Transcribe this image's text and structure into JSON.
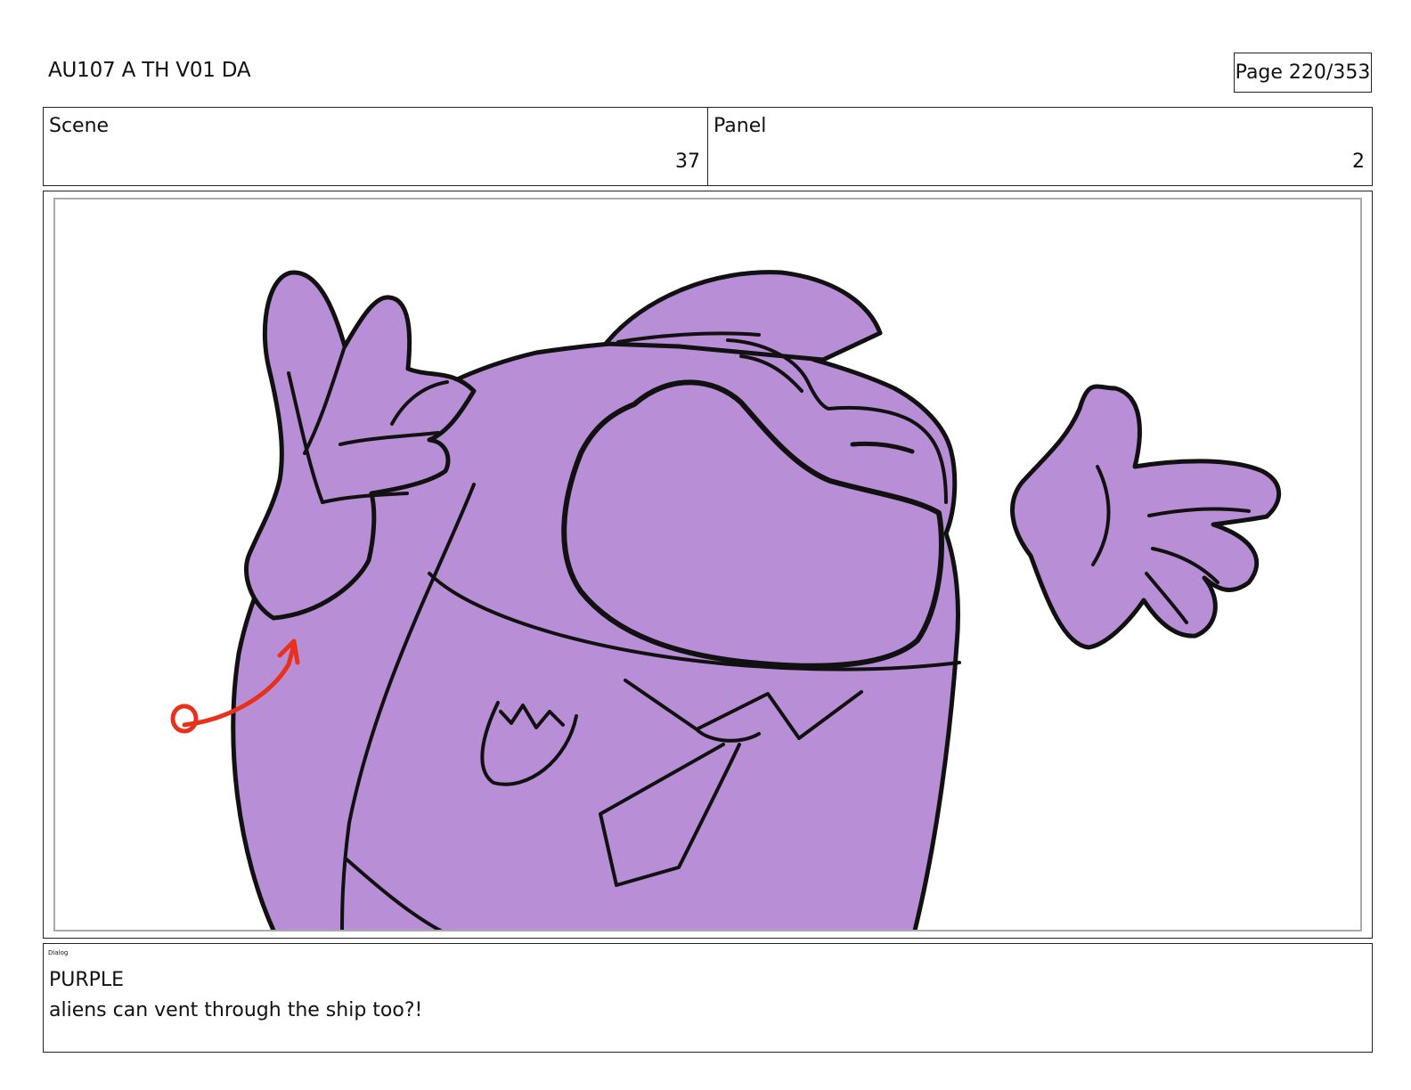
{
  "header": {
    "doc_title": "AU107 A TH V01 DA",
    "page_label": "Page 220/353"
  },
  "info": {
    "scene_label": "Scene",
    "scene_value": "37",
    "panel_label": "Panel",
    "panel_value": "2"
  },
  "artwork": {
    "character_color": "#b88fd6",
    "outline_color": "#111111",
    "annotation_color": "#e8301c",
    "icons": [
      "purple-crewmate-figure",
      "raised-left-hand",
      "pointing-right-hand",
      "red-annotation-arrow"
    ]
  },
  "dialog": {
    "label": "Dialog",
    "speaker": "PURPLE",
    "line": "aliens can vent through the ship too?!"
  }
}
